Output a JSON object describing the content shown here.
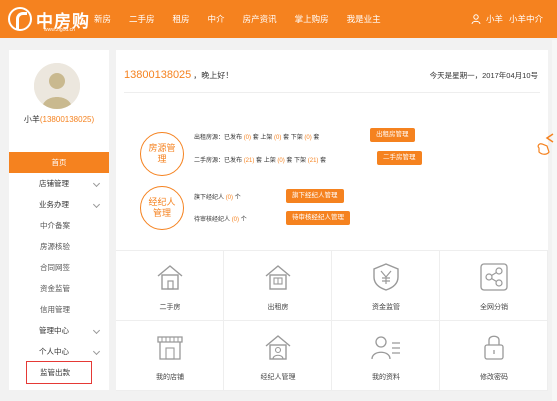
{
  "header": {
    "logo_text": "中房购",
    "logo_sub": "www.zfgou.cn",
    "nav": [
      "新房",
      "二手房",
      "租房",
      "中介",
      "房产资讯",
      "掌上购房",
      "我是业主"
    ],
    "user_name": "小羊",
    "user_org": "小羊中介"
  },
  "sidebar": {
    "user_label": "小羊",
    "user_phone": "(13800138025)",
    "menu": [
      {
        "label": "首页",
        "type": "active"
      },
      {
        "label": "店铺管理",
        "type": "group"
      },
      {
        "label": "业务办理",
        "type": "group"
      },
      {
        "label": "中介备案",
        "type": "sub"
      },
      {
        "label": "房源核验",
        "type": "sub"
      },
      {
        "label": "合同网签",
        "type": "sub"
      },
      {
        "label": "资金监管",
        "type": "sub"
      },
      {
        "label": "信用管理",
        "type": "sub"
      },
      {
        "label": "管理中心",
        "type": "group"
      },
      {
        "label": "个人中心",
        "type": "group"
      },
      {
        "label": "监管出款",
        "type": "highlight"
      }
    ]
  },
  "main": {
    "phone": "13800138025",
    "greeting": "，晚上好！",
    "date": "今天是星期一，2017年04月10号",
    "house": {
      "title": "房源管理",
      "rent_line": {
        "prefix": "出租房源：已发布",
        "published": "(0)",
        "up_label": "套 上架",
        "up": "(0)",
        "down_label": "套 下架",
        "down": "(0)",
        "suffix": "套"
      },
      "second_line": {
        "prefix": "二手房源：已发布",
        "published": "(21)",
        "up_label": "套 上架",
        "up": "(0)",
        "down_label": "套 下架",
        "down": "(21)",
        "suffix": "套"
      },
      "rent_btn": "出租房管理",
      "second_btn": "二手房管理"
    },
    "agent": {
      "title": "经纪人管理",
      "line1": {
        "prefix": "旗下经纪人",
        "num": "(0)",
        "suffix": "个"
      },
      "line2": {
        "prefix": "待审核经纪人",
        "num": "(0)",
        "suffix": "个"
      },
      "btn1": "旗下经纪人管理",
      "btn2": "待审核经纪人管理"
    },
    "tiles": [
      {
        "label": "二手房",
        "icon": "house-icon"
      },
      {
        "label": "出租房",
        "icon": "rent-house-icon"
      },
      {
        "label": "资金监管",
        "icon": "yuan-shield-icon"
      },
      {
        "label": "全网分销",
        "icon": "share-icon"
      },
      {
        "label": "我的店铺",
        "icon": "shop-icon"
      },
      {
        "label": "经纪人管理",
        "icon": "agent-house-icon"
      },
      {
        "label": "我的资料",
        "icon": "profile-icon"
      },
      {
        "label": "修改密码",
        "icon": "lock-icon"
      }
    ]
  },
  "colors": {
    "accent": "#f5821f",
    "highlight_border": "#e53935"
  }
}
